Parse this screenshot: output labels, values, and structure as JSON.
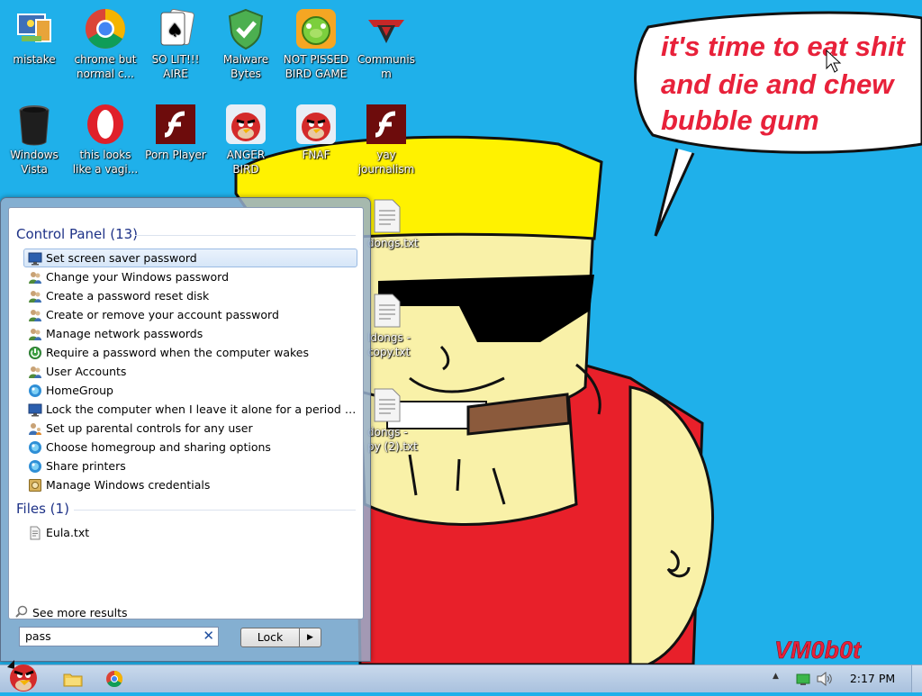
{
  "desktop_icons": [
    {
      "label": "mistake",
      "icon": "control-panel-icon"
    },
    {
      "label": "chrome but normal c...",
      "icon": "chrome-icon"
    },
    {
      "label": "SO LIT!!! AIRE",
      "icon": "solitaire-icon"
    },
    {
      "label": "Malware Bytes",
      "icon": "shield-check-icon"
    },
    {
      "label": "NOT PISSED BIRD GAME",
      "icon": "pig-icon"
    },
    {
      "label": "Communism",
      "icon": "emblem-icon"
    },
    {
      "label": "Windows Vista",
      "icon": "trash-bin-icon"
    },
    {
      "label": "this looks like a vagi...",
      "icon": "opera-icon"
    },
    {
      "label": "Porn Player",
      "icon": "flash-icon"
    },
    {
      "label": "ANGER BIRD",
      "icon": "angry-bird-icon"
    },
    {
      "label": "FNAF",
      "icon": "angry-bird-icon"
    },
    {
      "label": "yay journalism",
      "icon": "flash-icon"
    }
  ],
  "desktop_files": [
    {
      "label": "dongs.txt"
    },
    {
      "label": "ldongs - copy.txt"
    },
    {
      "label": "dongs - py (2).txt"
    }
  ],
  "wallpaper": {
    "speech_text": [
      "it's time to eat shit",
      "and die and chew",
      "bubble gum"
    ],
    "signature": "VM0b0t"
  },
  "start_menu": {
    "groups": [
      {
        "title": "Control Panel (13)",
        "items": [
          {
            "label": "Set screen saver password",
            "icon": "monitor-icon",
            "selected": true
          },
          {
            "label": "Change your Windows password",
            "icon": "users-icon"
          },
          {
            "label": "Create a password reset disk",
            "icon": "users-icon"
          },
          {
            "label": "Create or remove your account password",
            "icon": "users-icon"
          },
          {
            "label": "Manage network passwords",
            "icon": "users-icon"
          },
          {
            "label": "Require a password when the computer wakes",
            "icon": "power-options-icon"
          },
          {
            "label": "User Accounts",
            "icon": "users-icon"
          },
          {
            "label": "HomeGroup",
            "icon": "homegroup-icon"
          },
          {
            "label": "Lock the computer when I leave it alone for a period of ti...",
            "icon": "monitor-icon"
          },
          {
            "label": "Set up parental controls for any user",
            "icon": "parental-controls-icon"
          },
          {
            "label": "Choose homegroup and sharing options",
            "icon": "homegroup-icon"
          },
          {
            "label": "Share printers",
            "icon": "homegroup-icon"
          },
          {
            "label": "Manage Windows credentials",
            "icon": "credential-vault-icon"
          }
        ]
      },
      {
        "title": "Files (1)",
        "items": [
          {
            "label": "Eula.txt",
            "icon": "text-file-icon"
          }
        ]
      }
    ],
    "see_more": "See more results",
    "search_value": "pass",
    "lock_button": "Lock"
  },
  "taskbar": {
    "clock": "2:17 PM",
    "pinned": [
      {
        "name": "explorer-icon"
      },
      {
        "name": "chrome-icon"
      }
    ]
  },
  "colors": {
    "desktop_bg": "#1fb0ea",
    "speech_text": "#e8213a",
    "selection": "#d6e6f8"
  }
}
